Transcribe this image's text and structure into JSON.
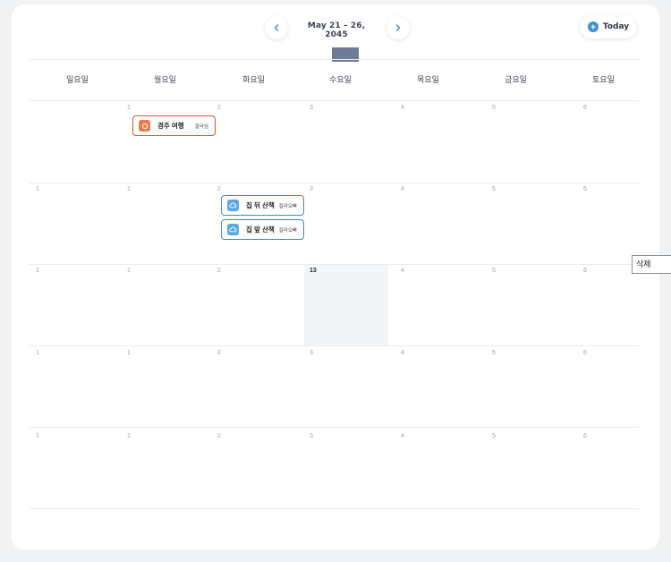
{
  "header": {
    "date_range": "May 21 – 26, 2045",
    "today_label": "Today",
    "prev_icon": "chevron-left-icon",
    "next_icon": "chevron-right-icon",
    "today_icon": "plus-circle-icon"
  },
  "weekdays": [
    "일요일",
    "월요일",
    "화요일",
    "수요일",
    "목요일",
    "금요일",
    "토요일"
  ],
  "weeks": [
    [
      "",
      "1",
      "2",
      "3",
      "4",
      "5",
      "6"
    ],
    [
      "1",
      "1",
      "2",
      "3",
      "4",
      "5",
      "6"
    ],
    [
      "1",
      "1",
      "2",
      "13",
      "4",
      "5",
      "6"
    ],
    [
      "1",
      "1",
      "2",
      "3",
      "4",
      "5",
      "6"
    ],
    [
      "1",
      "1",
      "2",
      "3",
      "4",
      "5",
      "6"
    ]
  ],
  "today_highlight": {
    "week": 2,
    "day": 3
  },
  "events": [
    {
      "title": "경주 여행",
      "tag": "잘라임",
      "icon": "circle-icon",
      "color": "#d4572b"
    },
    {
      "title": "집 뒤 산책",
      "tag": "잘라오빠",
      "icon": "cloud-icon",
      "color": "#3b8bd2"
    },
    {
      "title": "집 앞 산책",
      "tag": "잘라오빠",
      "icon": "cloud-icon",
      "color": "#3b8bd2"
    }
  ],
  "context_menu": {
    "delete_label": "삭제"
  },
  "colors": {
    "accent": "#3c8fda",
    "event_orange": "#d4572b",
    "event_blue": "#3b8bd2",
    "drag_handle": "#6f7a95"
  }
}
